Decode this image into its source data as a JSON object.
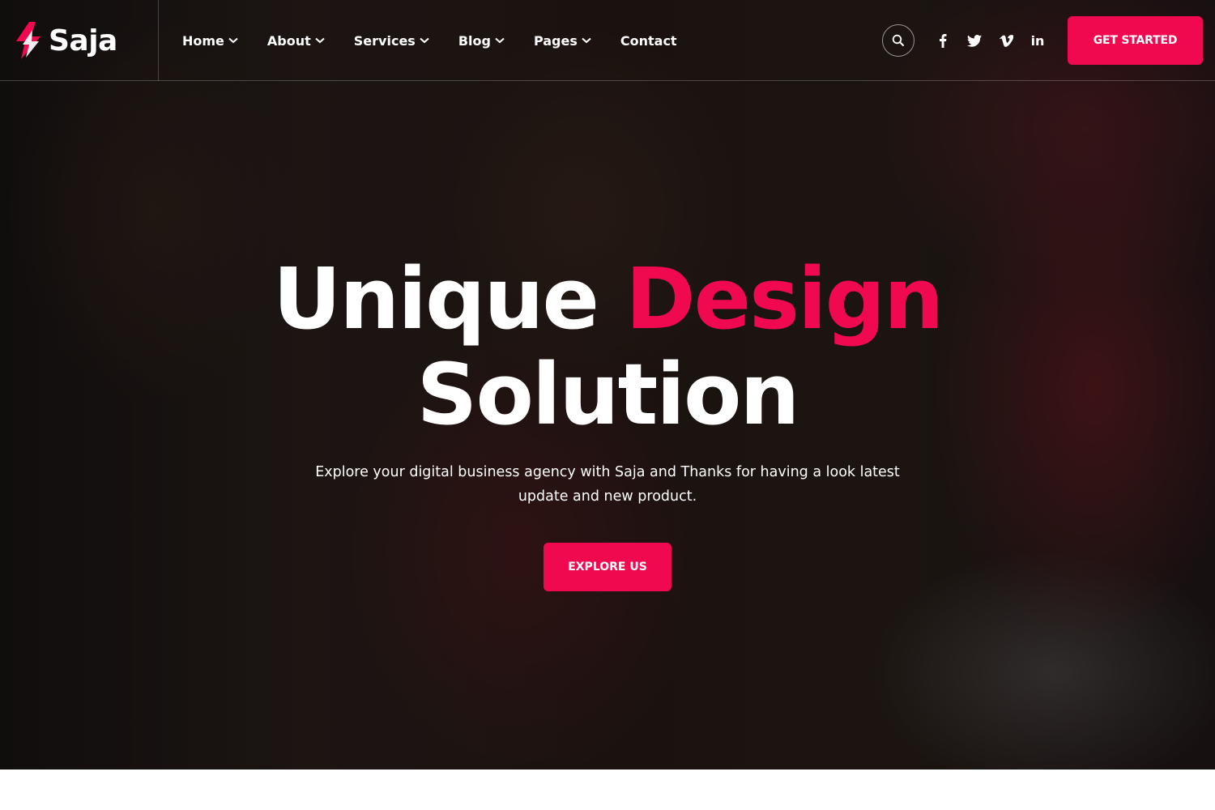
{
  "brand": {
    "name": "Saja",
    "accent_color": "#f0094f",
    "logo_icon": "lightning-bolt-icon"
  },
  "nav": {
    "items": [
      {
        "label": "Home",
        "has_dropdown": true
      },
      {
        "label": "About",
        "has_dropdown": true
      },
      {
        "label": "Services",
        "has_dropdown": true
      },
      {
        "label": "Blog",
        "has_dropdown": true
      },
      {
        "label": "Pages",
        "has_dropdown": true
      },
      {
        "label": "Contact",
        "has_dropdown": false
      }
    ]
  },
  "header": {
    "search_icon": "search-icon",
    "socials": [
      {
        "name": "facebook",
        "icon": "facebook-icon"
      },
      {
        "name": "twitter",
        "icon": "twitter-icon"
      },
      {
        "name": "vimeo",
        "icon": "vimeo-icon"
      },
      {
        "name": "linkedin",
        "icon": "linkedin-icon",
        "text": "in"
      }
    ],
    "cta_label": "GET STARTED"
  },
  "hero": {
    "title_part1": "Unique ",
    "title_accent": "Design",
    "title_line2": "Solution",
    "subtitle": "Explore your digital business agency with Saja and Thanks for having a look latest update and new product.",
    "button_label": "EXPLORE US"
  },
  "colors": {
    "accent": "#f0094f",
    "text": "#ffffff",
    "page_background": "#ffffff"
  }
}
